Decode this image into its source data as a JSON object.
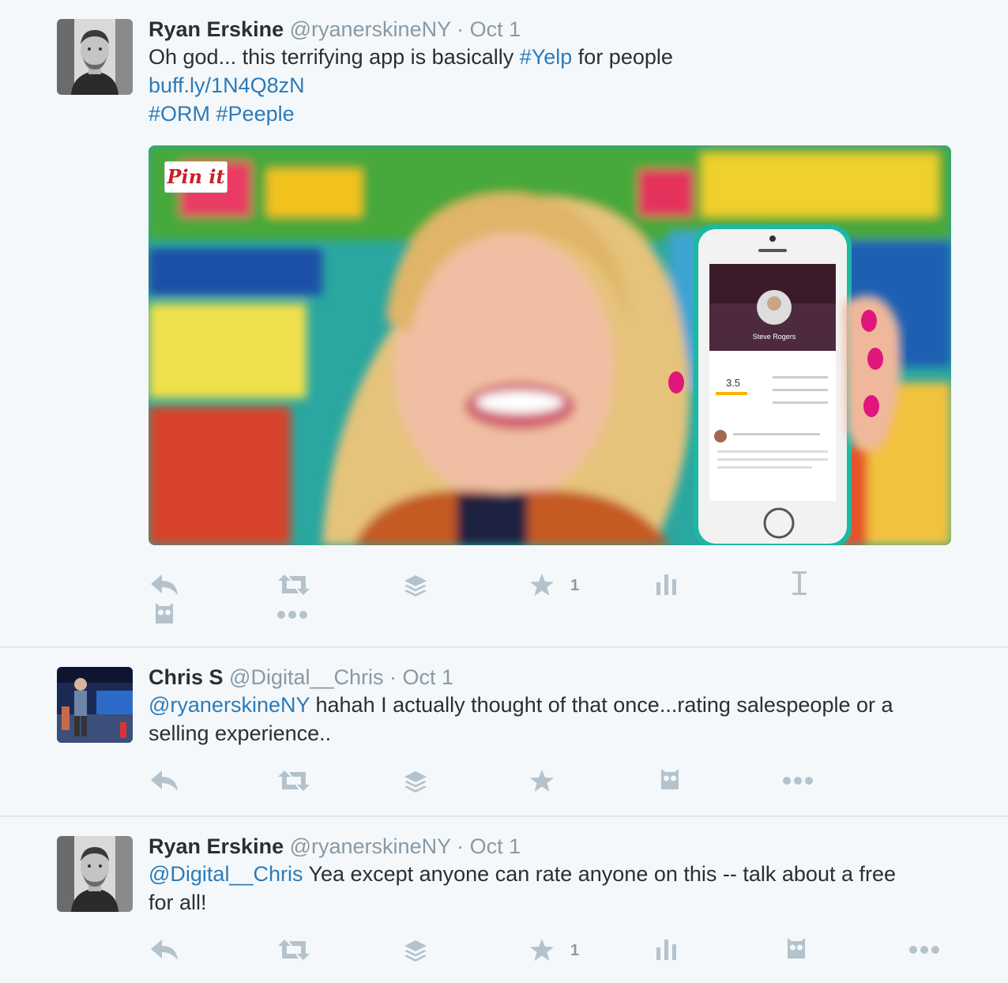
{
  "tweets": [
    {
      "name": "Ryan Erskine",
      "handle": "@ryanerskineNY",
      "time": "Oct 1",
      "text_prefix": "Oh god... this terrifying app is basically ",
      "hashtag_yelp": "#Yelp",
      "text_suffix": " for people",
      "link": "buff.ly/1N4Q8zN",
      "hashtags": [
        "#ORM",
        "#Peeple"
      ],
      "pin_label": "Pin it",
      "phone_profile_name": "Steve Rogers",
      "phone_rating": "3.5",
      "favorite_count": "1"
    },
    {
      "name": "Chris S",
      "handle": "@Digital__Chris",
      "time": "Oct 1",
      "mention": "@ryanerskineNY",
      "text_line1": " hahah I actually thought of that once...rating salespeople or a",
      "text_line2": "selling experience.."
    },
    {
      "name": "Ryan Erskine",
      "handle": "@ryanerskineNY",
      "time": "Oct 1",
      "mention": "@Digital__Chris",
      "text_line1": " Yea except anyone can rate anyone on this -- talk about a free",
      "text_line2": "for all!",
      "favorite_count": "1"
    }
  ],
  "separator": " · ",
  "icons": [
    "reply-icon",
    "retweet-icon",
    "buffer-icon",
    "favorite-icon",
    "analytics-icon",
    "text-cursor-icon",
    "owl-icon",
    "more-icon"
  ]
}
